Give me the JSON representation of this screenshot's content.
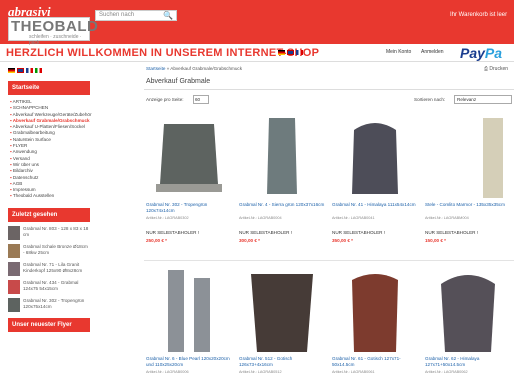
{
  "header": {
    "brand_top": "abrasivi",
    "brand_name": "THEOBALD",
    "brand_tag": "schleifen · zuschneide · pack",
    "search_placeholder": "Suchen nach",
    "cart": "Ihr Warenkorb ist leer"
  },
  "titlebar": {
    "welcome": "HERZLICH WILLKOMMEN IN UNSEREM INTERNET-SHOP",
    "account": "Mein Konto",
    "logout": "Anmelden",
    "paypal_a": "Pay",
    "paypal_b": "Pa"
  },
  "sidebar": {
    "start_heading": "Startseite",
    "items": [
      "ARTIKEL",
      "SCHNAPPCHEN",
      "Abverkauf Werkzeuge/Geräte/Zubehör",
      "Abverkauf Grabmale/Grabschmuck",
      "Abverkauf U-Platten/Fliesen/Sockel",
      "Grabmalbearbeitung",
      "Naturstein Surface",
      "FLYER",
      "Anwendung",
      "Versand",
      "Wir über uns",
      "Bildarchiv",
      "Datenschutz",
      "AGB",
      "Impressum",
      "Theobald Ausstellen"
    ],
    "active_index": 3,
    "recent_heading": "Zuletzt gesehen",
    "recent": [
      "Grabmal Nr. 803 - 128 x 83 x 18 cm",
      "Grabmal Schale Bronze Ø18cm - 68kw 25cm",
      "Grabmal Nr. 71 - Lila Granit Kinderkopf 125x90 Ø8x28cm",
      "Grabmal Nr. 434 - Grabmal 124x75 54x15cm",
      "Grabmal Nr. 302 - Tropengrün 120x75x14cm"
    ],
    "flyer_heading": "Unser neuester Flyer"
  },
  "main": {
    "breadcrumb_home": "Startseite",
    "breadcrumb_rest": "» Abverkauf Grabmale/Grabschmuck",
    "print": "Drucken",
    "title": "Abverkauf Grabmale",
    "per_page_label": "Anzeige pro Seite:",
    "per_page_value": "60",
    "sort_label": "Sortieren nach:",
    "sort_value": "Relevanz"
  },
  "products": [
    {
      "name": "Grabmal Nr. 302 - Tropengrün 120x74x14cm",
      "art": "Artikel-Nr.: LAGRAB0302",
      "pickup": "NUR SELBSTABHOLER !",
      "price": "250,00 € *",
      "color": "#5d6360"
    },
    {
      "name": "Grabmal Nr. 4 - Sierra grün 120x37x16cm",
      "art": "Artikel-Nr.: LAGRAB0004",
      "pickup": "NUR SELBSTABHOLER !",
      "price": "300,00 € *",
      "color": "#6e7b7d"
    },
    {
      "name": "Grabmal Nr. 41 - Himalaya 111x54x14cm",
      "art": "Artikel-Nr.: LAGRAB0041",
      "pickup": "NUR SELBSTABHOLER !",
      "price": "350,00 € *",
      "color": "#4d4d58"
    },
    {
      "name": "Stele - Comlito Marmor - 135x35x35cm",
      "art": "Artikel-Nr.: LAGRABM004",
      "pickup": "NUR SELBSTABHOLER !",
      "price": "150,00 € *",
      "color": "#d5cfb8"
    },
    {
      "name": "Grabmal Nr. 6 - Blue Pearl 120x20x20cm und 110x25x20cm",
      "art": "Artikel-Nr.: LAGRAB0006",
      "pickup": "",
      "price": "",
      "color": "#8c9197"
    },
    {
      "name": "Grabmal Nr. 512 - Gotisch 126x73+4x16cm",
      "art": "Artikel-Nr.: LAGRAB0512",
      "pickup": "",
      "price": "",
      "color": "#463b37"
    },
    {
      "name": "Grabmal Nr. 61 - Gotisch 127x71-50x14.5cm",
      "art": "Artikel-Nr.: LAGRAB0061",
      "pickup": "",
      "price": "",
      "color": "#7d3b2e"
    },
    {
      "name": "Grabmal Nr. 62 - Himalaya 127x71+50x14.5cm",
      "art": "Artikel-Nr.: LAGRAB0062",
      "pickup": "",
      "price": "",
      "color": "#555058"
    }
  ]
}
